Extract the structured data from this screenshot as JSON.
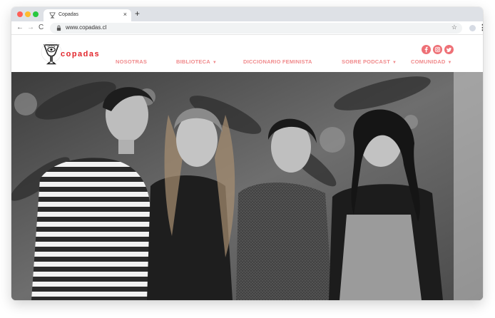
{
  "browser": {
    "tab_title": "Copadas",
    "tab_close": "×",
    "new_tab": "+",
    "url": "www.copadas.cl",
    "back": "←",
    "forward": "→",
    "reload": "C",
    "bookmark": "☆",
    "menu": "⋮"
  },
  "site": {
    "logo_text": "copadas",
    "nav": [
      {
        "label": "NOSOTRAS",
        "has_dropdown": false
      },
      {
        "label": "BIBLIOTECA",
        "has_dropdown": true
      },
      {
        "label": "DICCIONARIO FEMINISTA",
        "has_dropdown": false
      },
      {
        "label": "SOBRE PODCAST",
        "has_dropdown": true
      },
      {
        "label": "COMUNIDAD",
        "has_dropdown": true
      }
    ],
    "dropdown_caret": "▼",
    "social": [
      "facebook-icon",
      "instagram-icon",
      "twitter-icon"
    ],
    "colors": {
      "brand_red": "#e2252b",
      "nav_pink": "#f08a8c",
      "social_pink": "#ee7076"
    }
  },
  "hero": {
    "alt": "Black and white photo of four smiling women standing together in front of a painted mural"
  }
}
